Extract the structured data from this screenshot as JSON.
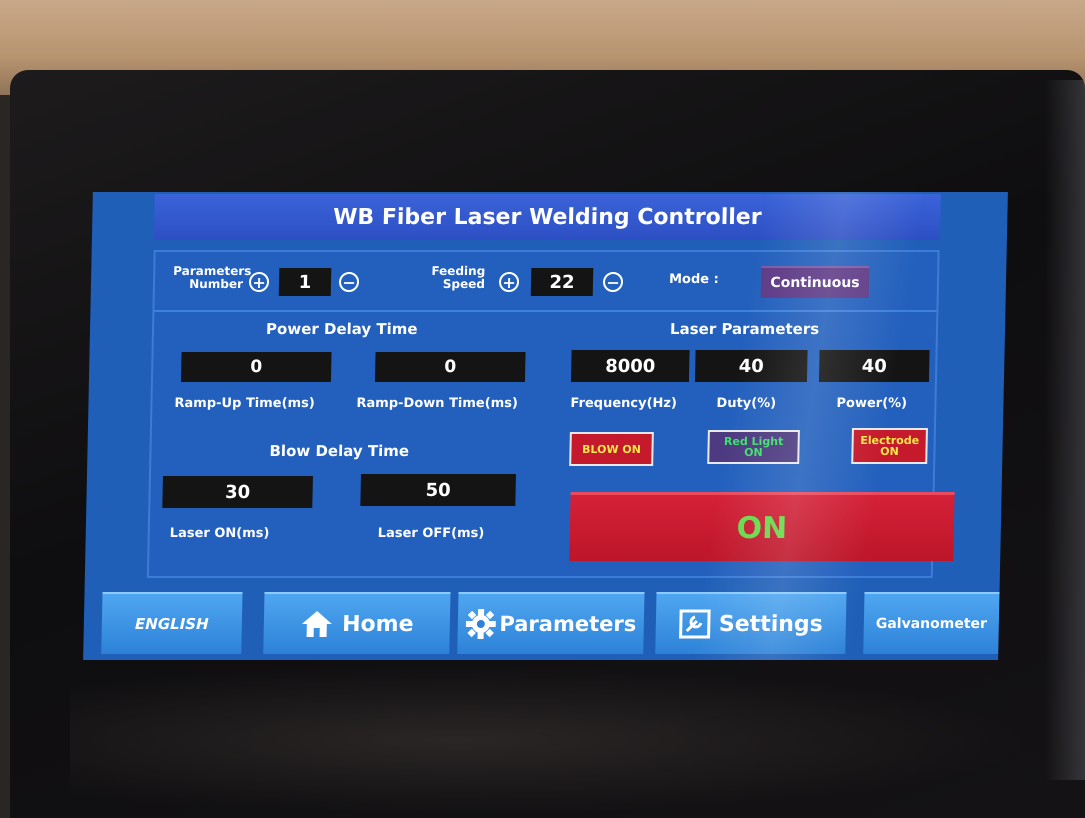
{
  "title": "WB Fiber Laser Welding Controller",
  "top": {
    "parameters_label_1": "Parameters",
    "parameters_label_2": "Number",
    "parameters_value": "1",
    "feeding_label_1": "Feeding",
    "feeding_label_2": "Speed",
    "feeding_value": "22",
    "mode_label": "Mode :",
    "mode_value": "Continuous",
    "plus_symbol": "+",
    "minus_symbol": "−"
  },
  "power_delay": {
    "title": "Power Delay Time",
    "ramp_up_value": "0",
    "ramp_down_value": "0",
    "ramp_up_label": "Ramp-Up Time(ms)",
    "ramp_down_label": "Ramp-Down Time(ms)"
  },
  "blow_delay": {
    "title": "Blow Delay Time",
    "laser_on_value": "30",
    "laser_off_value": "50",
    "laser_on_label": "Laser ON(ms)",
    "laser_off_label": "Laser OFF(ms)"
  },
  "laser_params": {
    "title": "Laser Parameters",
    "frequency_value": "8000",
    "duty_value": "40",
    "power_value": "40",
    "frequency_label": "Frequency(Hz)",
    "duty_label": "Duty(%)",
    "power_label": "Power(%)"
  },
  "toggles": {
    "blow_on": "BLOW ON",
    "red_light_1": "Red Light",
    "red_light_2": "ON",
    "electrode_1": "Electrode",
    "electrode_2": "ON"
  },
  "main_switch": "ON",
  "nav": {
    "english": "ENGLISH",
    "home": "Home",
    "parameters": "Parameters",
    "settings": "Settings",
    "galvanometer": "Galvanometer"
  },
  "icons": {
    "home": "house-icon",
    "parameters": "gear-icon",
    "settings": "wrench-icon"
  },
  "colors": {
    "screen_blue": "#1f5fb8",
    "title_blue": "#2d4fc4",
    "button_red": "#c51a2c",
    "on_green": "#66d94a",
    "mode_purple": "#5e3a86"
  }
}
